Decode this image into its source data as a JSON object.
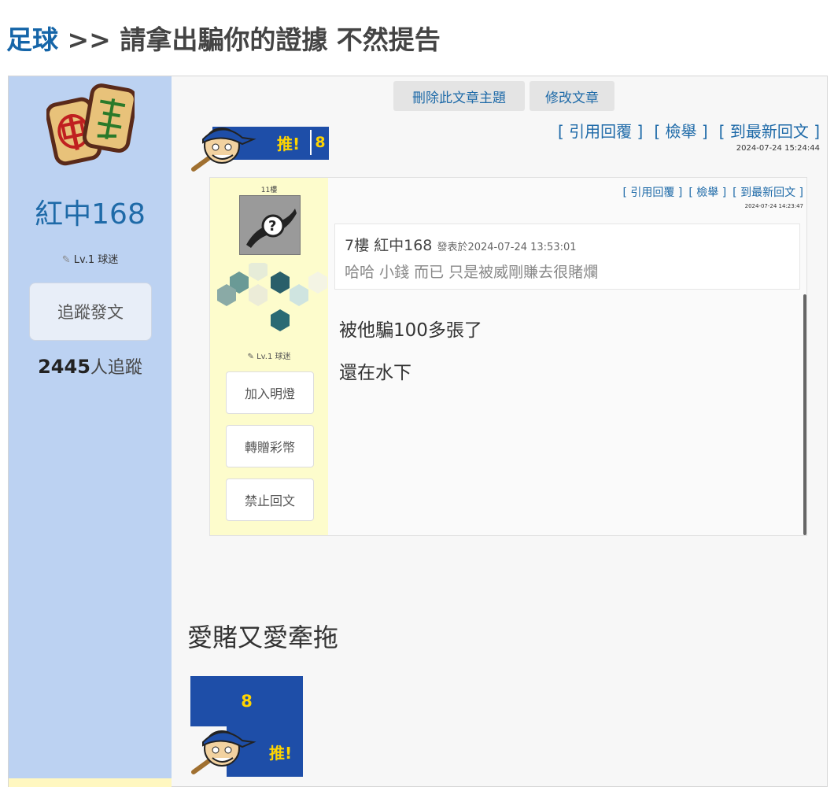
{
  "header": {
    "category": "足球",
    "separator": ">>",
    "title": "請拿出騙你的證據 不然提告"
  },
  "profile": {
    "username": "紅中168",
    "level": "Lv.1 球迷",
    "follow_button": "追蹤發文",
    "follower_count": "2445",
    "follower_suffix": "人追蹤"
  },
  "toolbar": {
    "delete_topic": "刪除此文章主題",
    "edit_post": "修改文章"
  },
  "post_actions": {
    "quote_reply": "[ 引用回覆 ]",
    "report": "[ 檢舉 ]",
    "latest_reply": "[ 到最新回文 ]",
    "timestamp": "2024-07-24 15:24:44"
  },
  "push_badge": {
    "label": "推!",
    "count": "8"
  },
  "quoted_reply": {
    "floor": "11樓",
    "level": "Lv.1 球迷",
    "buttons": [
      "加入明燈",
      "轉贈彩幣",
      "禁止回文"
    ],
    "quote_reply": "[ 引用回覆 ]",
    "report": "[ 檢舉 ]",
    "latest_reply": "[ 到最新回文 ]",
    "timestamp": "2024-07-24 14:23:47",
    "inner_quote": {
      "header": "7樓 紅中168",
      "posted": "發表於2024-07-24 13:53:01",
      "body": "哈哈 小錢 而已 只是被威剛賺去很賭爛"
    },
    "lines": [
      "被他騙100多張了",
      "還在水下"
    ]
  },
  "main_post": {
    "text": "愛賭又愛牽拖"
  },
  "bottom_push": {
    "count": "8",
    "label": "推!"
  }
}
